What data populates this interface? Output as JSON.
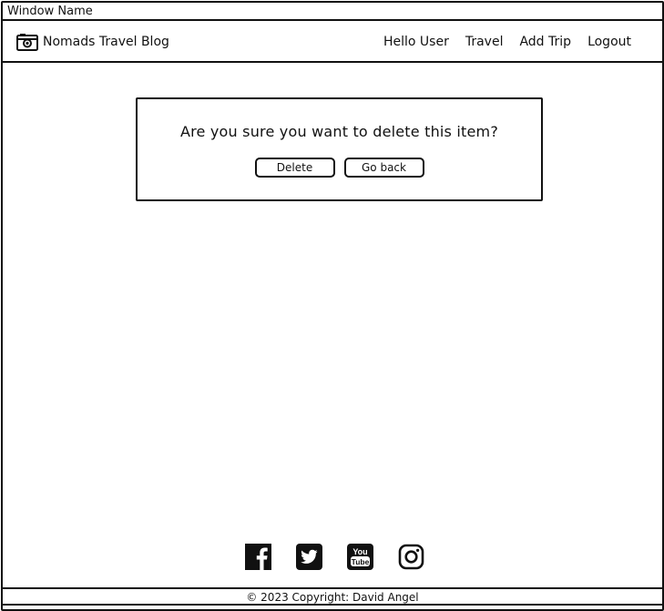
{
  "window": {
    "title": "Window Name"
  },
  "navbar": {
    "brand_icon": "camera-icon",
    "brand": "Nomads Travel Blog",
    "links": [
      "Hello User",
      "Travel",
      "Add Trip",
      "Logout"
    ]
  },
  "dialog": {
    "message": "Are you sure you want to delete this item?",
    "delete_label": "Delete",
    "back_label": "Go back"
  },
  "social": {
    "icons": [
      "facebook-icon",
      "twitter-icon",
      "youtube-icon",
      "instagram-icon"
    ],
    "youtube_text": [
      "You",
      "Tube"
    ]
  },
  "footer": {
    "text": "© 2023 Copyright: David Angel"
  },
  "colors": {
    "ink": "#111111",
    "background": "#ffffff"
  }
}
